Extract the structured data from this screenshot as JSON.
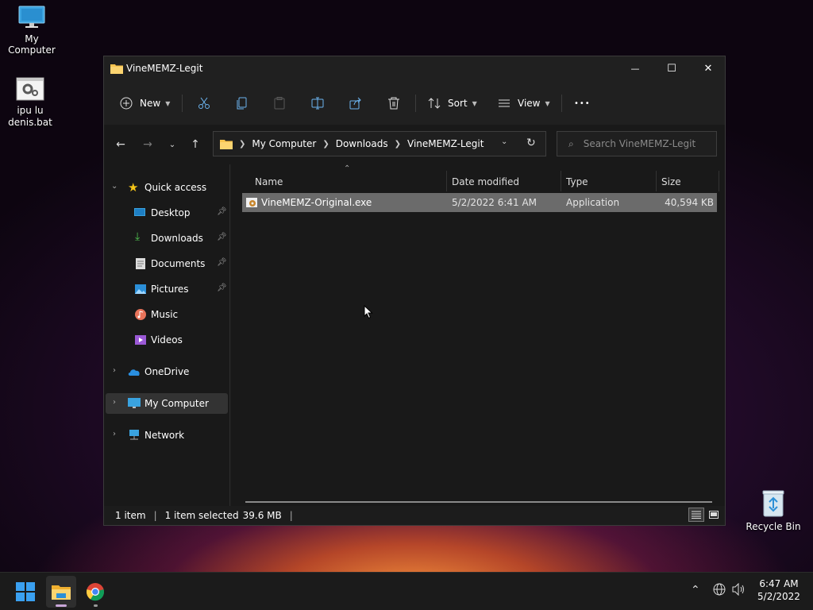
{
  "desktop": {
    "icons": [
      {
        "label": "My Computer"
      },
      {
        "label": "ipu lu denis.bat"
      },
      {
        "label": "Recycle Bin"
      }
    ]
  },
  "window": {
    "title": "VineMEMZ-Legit",
    "controls": {
      "minimize": "—",
      "maximize": "☐",
      "close": "✕"
    }
  },
  "toolbar": {
    "new_label": "New",
    "sort_label": "Sort",
    "view_label": "View",
    "more_label": "•••"
  },
  "navigation": {
    "breadcrumbs": [
      "My Computer",
      "Downloads",
      "VineMEMZ-Legit"
    ],
    "search_placeholder": "Search VineMEMZ-Legit"
  },
  "sidebar": {
    "quick_access": "Quick access",
    "quick_items": [
      {
        "label": "Desktop",
        "icon": "desktop-icon",
        "pinned": true
      },
      {
        "label": "Downloads",
        "icon": "download-icon",
        "pinned": true
      },
      {
        "label": "Documents",
        "icon": "document-icon",
        "pinned": true
      },
      {
        "label": "Pictures",
        "icon": "picture-icon",
        "pinned": true
      },
      {
        "label": "Music",
        "icon": "music-icon",
        "pinned": false
      },
      {
        "label": "Videos",
        "icon": "video-icon",
        "pinned": false
      }
    ],
    "onedrive": "OneDrive",
    "my_computer": "My Computer",
    "network": "Network"
  },
  "columns": {
    "name": "Name",
    "date": "Date modified",
    "type": "Type",
    "size": "Size"
  },
  "files": [
    {
      "name": "VineMEMZ-Original.exe",
      "date": "5/2/2022 6:41 AM",
      "type": "Application",
      "size": "40,594 KB",
      "selected": true
    }
  ],
  "status": {
    "count": "1 item",
    "selection": "1 item selected",
    "selection_size": "39.6 MB"
  },
  "taskbar": {
    "time": "6:47 AM",
    "date": "5/2/2022"
  },
  "colors": {
    "accent": "#0078d4",
    "selection": "#6b6b6b",
    "folder": "#f8c44f"
  }
}
